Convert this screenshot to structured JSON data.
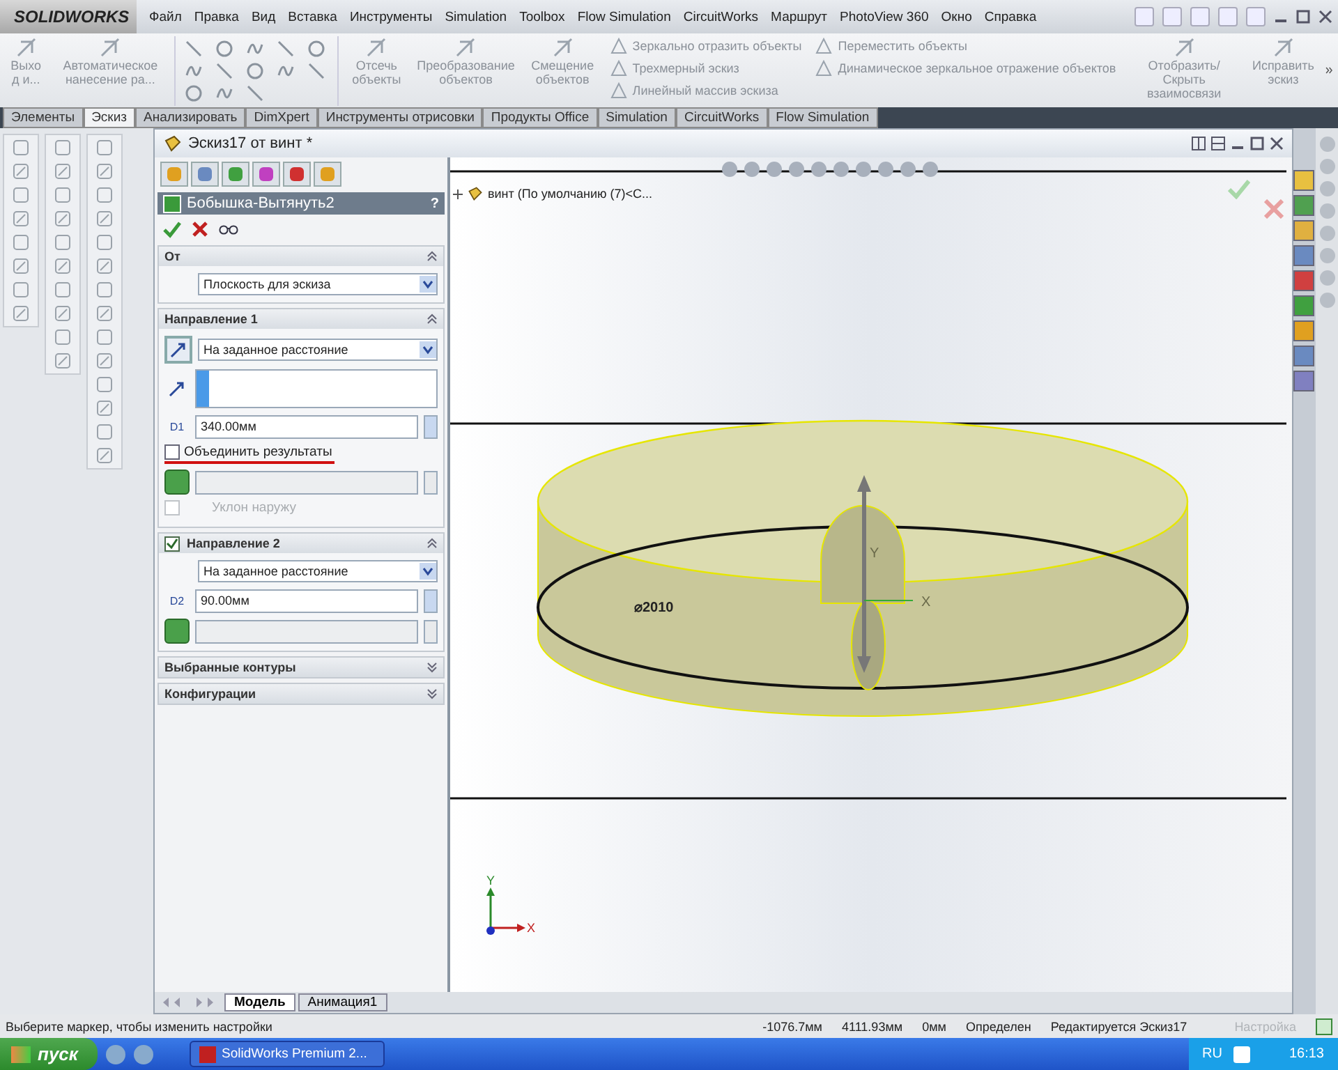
{
  "app": {
    "logo": "SOLIDWORKS"
  },
  "menu": [
    {
      "label": "Файл"
    },
    {
      "label": "Правка"
    },
    {
      "label": "Вид"
    },
    {
      "label": "Вставка"
    },
    {
      "label": "Инструменты"
    },
    {
      "label": "Simulation"
    },
    {
      "label": "Toolbox"
    },
    {
      "label": "Flow Simulation"
    },
    {
      "label": "CircuitWorks"
    },
    {
      "label": "Маршрут"
    },
    {
      "label": "PhotoView 360"
    },
    {
      "label": "Окно"
    },
    {
      "label": "Справка"
    }
  ],
  "ribbon": [
    {
      "kind": "large",
      "label": "Выхо д и..."
    },
    {
      "kind": "large",
      "label": "Автоматическое нанесение ра..."
    },
    {
      "kind": "tools"
    },
    {
      "kind": "large",
      "label": "Отсечь объекты"
    },
    {
      "kind": "large",
      "label": "Преобразование объектов"
    },
    {
      "kind": "large",
      "label": "Смещение объектов"
    },
    {
      "kind": "small",
      "items": [
        "Зеркально отразить объекты",
        "Трехмерный эскиз",
        "Линейный массив эскиза"
      ]
    },
    {
      "kind": "small",
      "items": [
        "Переместить объекты",
        "Динамическое зеркальное отражение объектов"
      ]
    },
    {
      "kind": "large",
      "label": "Отобразить/Скрыть взаимосвязи"
    },
    {
      "kind": "large",
      "label": "Исправить эскиз"
    }
  ],
  "command_tabs": [
    {
      "label": "Элементы",
      "selected": false
    },
    {
      "label": "Эскиз",
      "selected": true
    },
    {
      "label": "Анализировать",
      "selected": false
    },
    {
      "label": "DimXpert",
      "selected": false
    },
    {
      "label": "Инструменты отрисовки",
      "selected": false
    },
    {
      "label": "Продукты Office",
      "selected": false
    },
    {
      "label": "Simulation",
      "selected": false
    },
    {
      "label": "CircuitWorks",
      "selected": false
    },
    {
      "label": "Flow Simulation",
      "selected": false
    }
  ],
  "document": {
    "title": "Эскиз17 от винт *"
  },
  "property_manager": {
    "title": "Бобышка-Вытянуть2",
    "help": "?",
    "sections": [
      {
        "title": "От",
        "expanded": true,
        "rows": [
          {
            "kind": "select",
            "value": "Плоскость для эскиза"
          }
        ]
      },
      {
        "title": "Направление 1",
        "expanded": true,
        "rows": [
          {
            "kind": "select",
            "icon": true,
            "value": "На заданное расстояние"
          },
          {
            "kind": "list"
          },
          {
            "kind": "number",
            "tag": "D1",
            "value": "340.00мм"
          },
          {
            "kind": "checkbox",
            "label": "Объединить результаты",
            "checked": false,
            "disabled": false,
            "underlined": true
          },
          {
            "kind": "body"
          },
          {
            "kind": "checkbox",
            "label": "Уклон наружу",
            "checked": false,
            "disabled": true,
            "underlined": false
          }
        ]
      },
      {
        "title": "Направление 2",
        "checkbox": true,
        "checked": true,
        "expanded": true,
        "rows": [
          {
            "kind": "select",
            "value": "На заданное расстояние"
          },
          {
            "kind": "number",
            "tag": "D2",
            "value": "90.00мм"
          },
          {
            "kind": "body"
          }
        ]
      },
      {
        "title": "Выбранные контуры",
        "expanded": false
      },
      {
        "title": "Конфигурации",
        "expanded": false
      }
    ]
  },
  "tree": {
    "label": "винт  (По умолчанию (7)<С..."
  },
  "viewport": {
    "dimension": "⌀2010",
    "axis_y": "Y",
    "axis_x": "X",
    "triad_y": "Y",
    "triad_x": "X"
  },
  "bottom_tabs": [
    {
      "label": "Модель",
      "selected": true
    },
    {
      "label": "Анимация1",
      "selected": false
    }
  ],
  "status_bar": {
    "message": "Выберите маркер, чтобы изменить настройки",
    "fields": [
      "-1076.7мм",
      "4111.93мм",
      "0мм",
      "Определен",
      "Редактируется Эскиз17"
    ],
    "settings": "Настройка"
  },
  "taskbar": {
    "start": "пуск",
    "tasks": [
      {
        "label": "SolidWorks Premium 2..."
      }
    ],
    "language": "RU",
    "clock": "16:13"
  }
}
